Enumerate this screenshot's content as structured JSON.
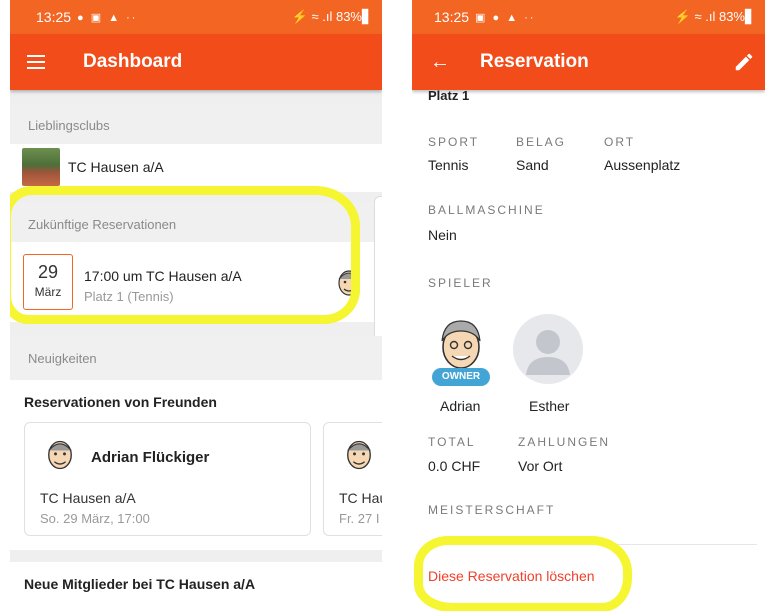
{
  "colors": {
    "accent": "#f24c1a",
    "statusbar": "#f26522",
    "highlight": "#f5f532",
    "owner_badge": "#42a5d6",
    "delete": "#f0402a"
  },
  "left": {
    "status": {
      "time": "13:25",
      "icons": "● ▣ ▲  ··",
      "right": "⚡ ≈ .ıl 83%▋"
    },
    "appbar": {
      "title": "Dashboard",
      "menu_icon": "menu-icon"
    },
    "favorites": {
      "header": "Lieblingsclubs",
      "club": "TC Hausen a/A"
    },
    "upcoming": {
      "header": "Zukünftige Reservationen",
      "day": "29",
      "month": "März",
      "title": "17:00 um TC Hausen a/A",
      "subtitle": "Platz 1 (Tennis)"
    },
    "news_header": "Neuigkeiten",
    "friends": {
      "header": "Reservationen von Freunden",
      "cards": [
        {
          "name": "Adrian Flückiger",
          "club": "TC Hausen a/A",
          "when": "So. 29 März, 17:00"
        },
        {
          "name": "",
          "club": "TC Hau",
          "when": "Fr. 27 I"
        }
      ]
    },
    "new_members_header": "Neue Mitglieder bei TC Hausen a/A"
  },
  "right": {
    "status": {
      "time": "13:25",
      "icons": "▣ ● ▲  ··",
      "right": "⚡ ≈ .ıl 83%▋"
    },
    "appbar": {
      "title": "Reservation",
      "back_icon": "back-arrow-icon",
      "edit_icon": "pencil-icon"
    },
    "court_partial": "Platz 1",
    "details": {
      "sport_label": "SPORT",
      "sport_value": "Tennis",
      "belag_label": "BELAG",
      "belag_value": "Sand",
      "ort_label": "ORT",
      "ort_value": "Aussenplatz",
      "ball_label": "BALLMASCHINE",
      "ball_value": "Nein",
      "players_label": "SPIELER",
      "players": [
        {
          "name": "Adrian",
          "badge": "OWNER"
        },
        {
          "name": "Esther",
          "badge": ""
        }
      ],
      "total_label": "TOTAL",
      "total_value": "0.0 CHF",
      "payments_label": "ZAHLUNGEN",
      "payments_value": "Vor Ort",
      "championship_label": "MEISTERSCHAFT"
    },
    "delete_label": "Diese Reservation löschen"
  }
}
